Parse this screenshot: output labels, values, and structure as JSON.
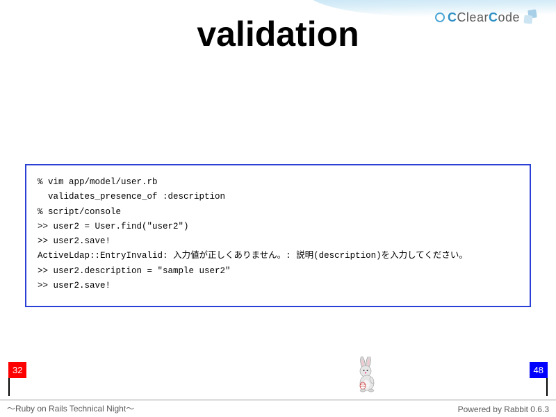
{
  "logo": {
    "text_pre": "Clear",
    "text_post": "ode"
  },
  "title": "validation",
  "code_lines": [
    "% vim app/model/user.rb",
    "  validates_presence_of :description",
    "% script/console",
    ">> user2 = User.find(\"user2\")",
    ">> user2.save!",
    "ActiveLdap::EntryInvalid: 入力値が正しくありません。: 説明(description)を入力してください。",
    ">> user2.description = \"sample user2\"",
    ">> user2.save!"
  ],
  "flags": {
    "left": "32",
    "right": "48"
  },
  "footer": {
    "left": "～Ruby on Rails Technical Night～",
    "right": "Powered by Rabbit 0.6.3"
  }
}
